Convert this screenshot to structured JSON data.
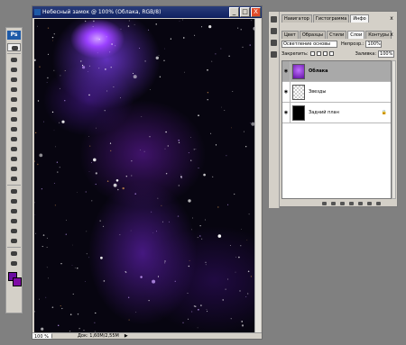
{
  "document": {
    "title": "Небесный замок @ 100% (Облака, RGB/8)",
    "minimize_label": "_",
    "maximize_label": "□",
    "close_label": "X",
    "zoom": "100 %",
    "doc_info": "Док: 1,60M/2,55M",
    "status_arrow": "▶"
  },
  "toolbox": {
    "app_badge": "Ps",
    "tools": [
      "move-icon",
      "marquee-icon",
      "lasso-icon",
      "magic-wand-icon",
      "crop-icon",
      "slice-icon",
      "healing-brush-icon",
      "brush-icon",
      "clone-stamp-icon",
      "history-brush-icon",
      "eraser-icon",
      "gradient-icon",
      "blur-icon",
      "dodge-icon",
      "pen-icon",
      "type-icon",
      "path-select-icon",
      "shape-icon",
      "notes-icon",
      "eyedropper-icon",
      "hand-icon",
      "zoom-icon"
    ],
    "foreground_color": "#6a0aa0",
    "background_color": "#7f0aa5"
  },
  "palette": {
    "top_tabs": [
      "Навигатор",
      "Гистограмма",
      "Инфо"
    ],
    "top_close": "x",
    "layer_tabs": [
      "Цвет",
      "Образцы",
      "Стили",
      "Слои",
      "Контуры"
    ],
    "layer_close": "x",
    "blend_mode": "Осветление основы",
    "opacity_label": "Непрозр.:",
    "opacity_value": "100%",
    "lock_label": "Закрепить:",
    "fill_label": "Заливка:",
    "fill_value": "100%",
    "layers": [
      {
        "name": "Облака",
        "thumb": "purple",
        "selected": true,
        "visible": true,
        "locked": false
      },
      {
        "name": "Звезды",
        "thumb": "check",
        "selected": false,
        "visible": true,
        "locked": false
      },
      {
        "name": "Задний план",
        "thumb": "black",
        "selected": false,
        "visible": true,
        "locked": true
      }
    ],
    "bottom_icons": [
      "link-layers-icon",
      "fx-icon",
      "mask-icon",
      "adjustment-icon",
      "group-icon",
      "new-layer-icon",
      "trash-icon"
    ]
  }
}
